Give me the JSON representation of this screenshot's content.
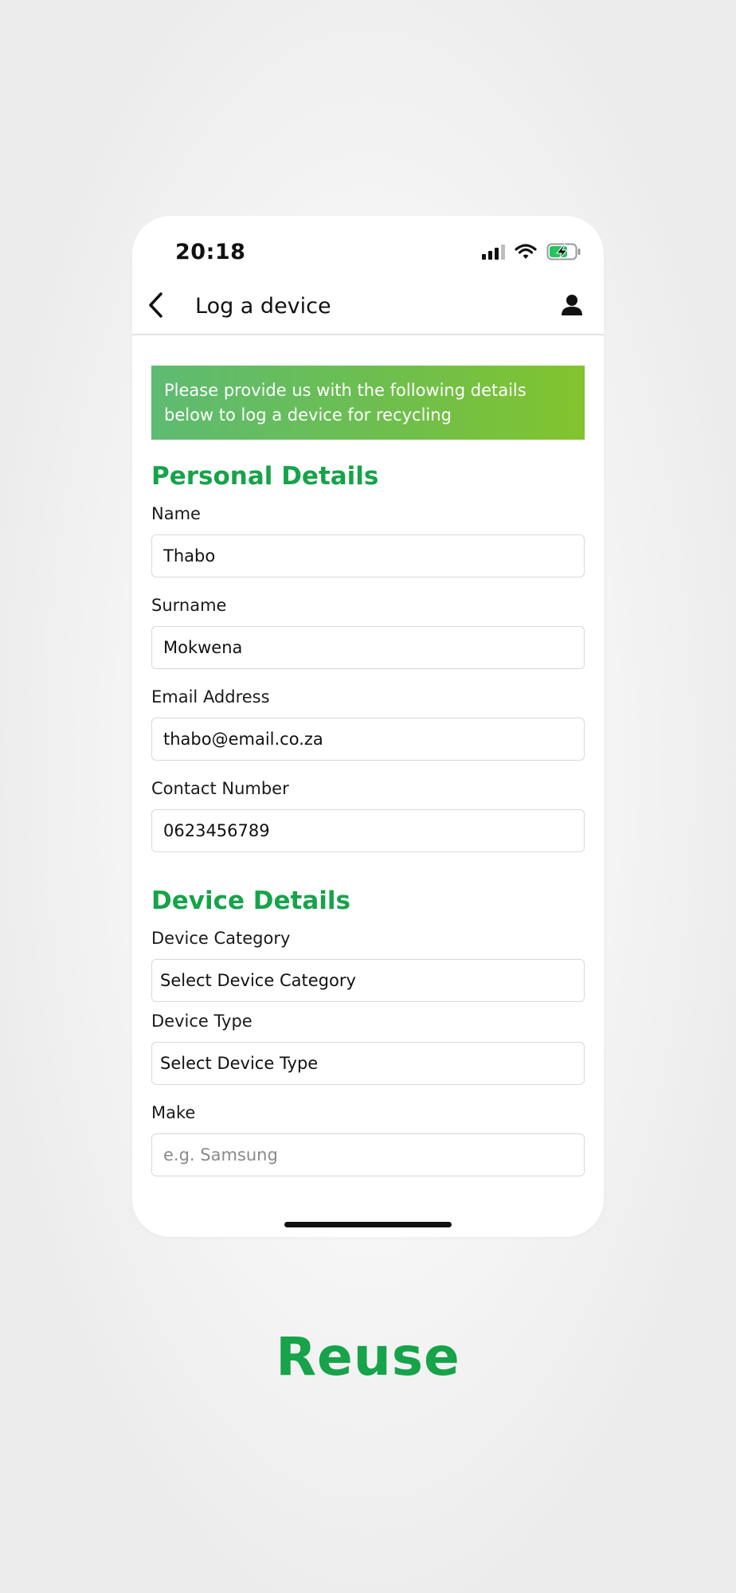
{
  "status_bar": {
    "time": "20:18",
    "icons": [
      "cellular-signal-icon",
      "wifi-icon",
      "battery-charging-icon"
    ],
    "battery_color": "#22c55e"
  },
  "nav": {
    "title": "Log a device",
    "back_icon": "chevron-left-icon",
    "profile_icon": "user-icon"
  },
  "banner": {
    "line1": "Please provide us with the following details",
    "line2": "below to log a device for recycling"
  },
  "personal": {
    "title": "Personal Details",
    "name_label": "Name",
    "name_value": "Thabo",
    "surname_label": "Surname",
    "surname_value": "Mokwena",
    "email_label": "Email Address",
    "email_value": "thabo@email.co.za",
    "contact_label": "Contact Number",
    "contact_value": "0623456789"
  },
  "device": {
    "title": "Device Details",
    "category_label": "Device Category",
    "category_value": "Select Device Category",
    "type_label": "Device Type",
    "type_value": "Select Device Type",
    "make_label": "Make",
    "make_placeholder": "e.g. Samsung"
  },
  "brand_word": "Reuse",
  "colors": {
    "accent": "#16a34a",
    "banner_start": "#5dbb72",
    "banner_end": "#82c42e"
  }
}
